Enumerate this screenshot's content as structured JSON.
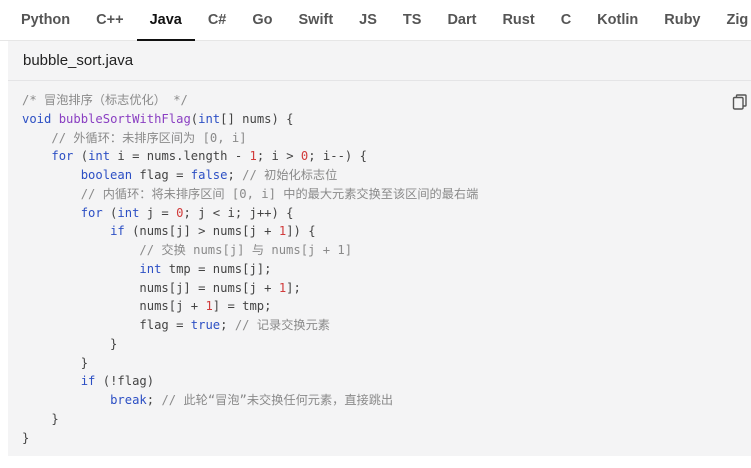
{
  "tabs": [
    {
      "label": "Python"
    },
    {
      "label": "C++"
    },
    {
      "label": "Java",
      "active": true
    },
    {
      "label": "C#"
    },
    {
      "label": "Go"
    },
    {
      "label": "Swift"
    },
    {
      "label": "JS"
    },
    {
      "label": "TS"
    },
    {
      "label": "Dart"
    },
    {
      "label": "Rust"
    },
    {
      "label": "C"
    },
    {
      "label": "Kotlin"
    },
    {
      "label": "Ruby"
    },
    {
      "label": "Zig"
    }
  ],
  "file": {
    "name": "bubble_sort.java"
  },
  "copy_icon": "copy-icon",
  "colors": {
    "keyword": "#2c4fc4",
    "function": "#8a3fc2",
    "number": "#d13b3b",
    "comment": "#8a8a8a",
    "active_tab_underline": "#111111"
  },
  "code": {
    "lines": [
      [
        {
          "t": "cm",
          "v": "/* 冒泡排序（标志优化） */"
        }
      ],
      [
        {
          "t": "kw",
          "v": "void"
        },
        {
          "t": "",
          "v": " "
        },
        {
          "t": "fn",
          "v": "bubbleSortWithFlag"
        },
        {
          "t": "",
          "v": "("
        },
        {
          "t": "kw",
          "v": "int"
        },
        {
          "t": "",
          "v": "[] nums) {"
        }
      ],
      [
        {
          "t": "",
          "v": "    "
        },
        {
          "t": "cm",
          "v": "// 外循环：未排序区间为 [0, i]"
        }
      ],
      [
        {
          "t": "",
          "v": "    "
        },
        {
          "t": "kw",
          "v": "for"
        },
        {
          "t": "",
          "v": " ("
        },
        {
          "t": "kw",
          "v": "int"
        },
        {
          "t": "",
          "v": " i = nums.length - "
        },
        {
          "t": "num",
          "v": "1"
        },
        {
          "t": "",
          "v": "; i > "
        },
        {
          "t": "num",
          "v": "0"
        },
        {
          "t": "",
          "v": "; i--) {"
        }
      ],
      [
        {
          "t": "",
          "v": "        "
        },
        {
          "t": "kw",
          "v": "boolean"
        },
        {
          "t": "",
          "v": " flag = "
        },
        {
          "t": "kw",
          "v": "false"
        },
        {
          "t": "",
          "v": "; "
        },
        {
          "t": "cm",
          "v": "// 初始化标志位"
        }
      ],
      [
        {
          "t": "",
          "v": "        "
        },
        {
          "t": "cm",
          "v": "// 内循环：将未排序区间 [0, i] 中的最大元素交换至该区间的最右端"
        }
      ],
      [
        {
          "t": "",
          "v": "        "
        },
        {
          "t": "kw",
          "v": "for"
        },
        {
          "t": "",
          "v": " ("
        },
        {
          "t": "kw",
          "v": "int"
        },
        {
          "t": "",
          "v": " j = "
        },
        {
          "t": "num",
          "v": "0"
        },
        {
          "t": "",
          "v": "; j < i; j++) {"
        }
      ],
      [
        {
          "t": "",
          "v": "            "
        },
        {
          "t": "kw",
          "v": "if"
        },
        {
          "t": "",
          "v": " (nums[j] > nums[j + "
        },
        {
          "t": "num",
          "v": "1"
        },
        {
          "t": "",
          "v": "]) {"
        }
      ],
      [
        {
          "t": "",
          "v": "                "
        },
        {
          "t": "cm",
          "v": "// 交换 nums[j] 与 nums[j + 1]"
        }
      ],
      [
        {
          "t": "",
          "v": "                "
        },
        {
          "t": "kw",
          "v": "int"
        },
        {
          "t": "",
          "v": " tmp = nums[j];"
        }
      ],
      [
        {
          "t": "",
          "v": "                nums[j] = nums[j + "
        },
        {
          "t": "num",
          "v": "1"
        },
        {
          "t": "",
          "v": "];"
        }
      ],
      [
        {
          "t": "",
          "v": "                nums[j + "
        },
        {
          "t": "num",
          "v": "1"
        },
        {
          "t": "",
          "v": "] = tmp;"
        }
      ],
      [
        {
          "t": "",
          "v": "                flag = "
        },
        {
          "t": "kw",
          "v": "true"
        },
        {
          "t": "",
          "v": "; "
        },
        {
          "t": "cm",
          "v": "// 记录交换元素"
        }
      ],
      [
        {
          "t": "",
          "v": "            }"
        }
      ],
      [
        {
          "t": "",
          "v": "        }"
        }
      ],
      [
        {
          "t": "",
          "v": "        "
        },
        {
          "t": "kw",
          "v": "if"
        },
        {
          "t": "",
          "v": " (!flag)"
        }
      ],
      [
        {
          "t": "",
          "v": "            "
        },
        {
          "t": "kw",
          "v": "break"
        },
        {
          "t": "",
          "v": "; "
        },
        {
          "t": "cm",
          "v": "// 此轮“冒泡”未交换任何元素，直接跳出"
        }
      ],
      [
        {
          "t": "",
          "v": "    }"
        }
      ],
      [
        {
          "t": "",
          "v": "}"
        }
      ]
    ]
  }
}
